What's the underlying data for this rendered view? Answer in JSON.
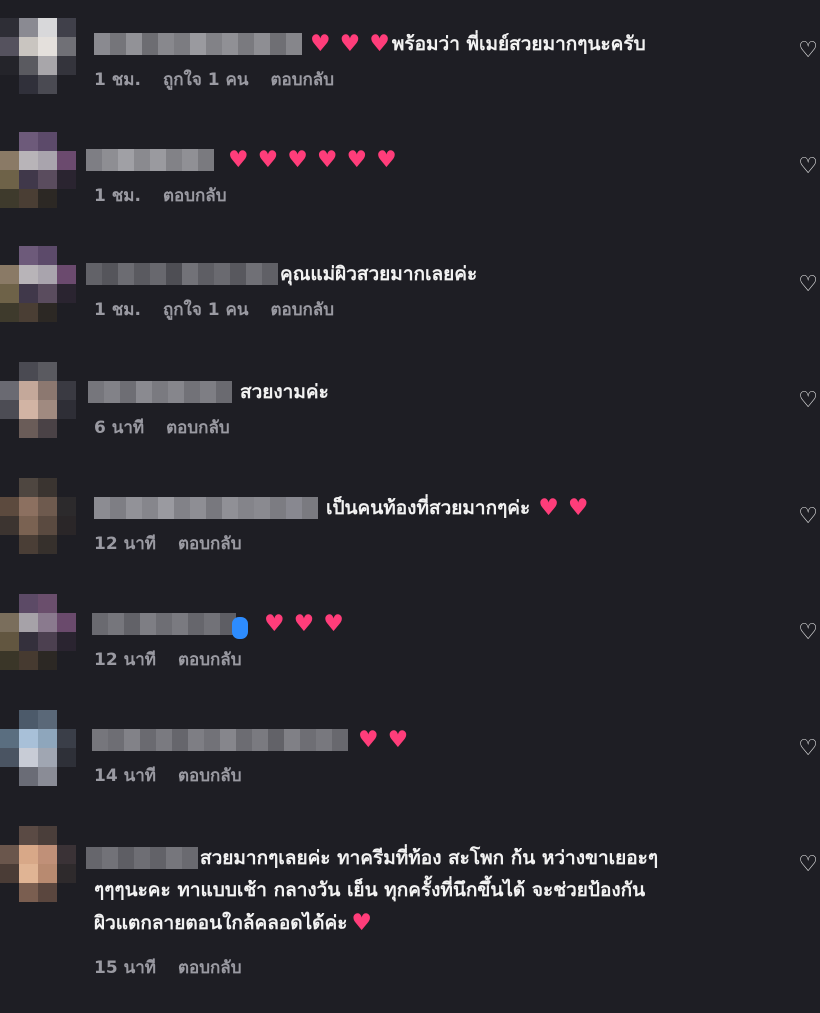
{
  "comments": [
    {
      "text": "พร้อมว่า  พี่เมย์สวยมากๆนะครับ",
      "hearts": 3,
      "heart_first": true,
      "time": "1 ชม.",
      "likes": "ถูกใจ 1 คน",
      "reply": "ตอบกลับ"
    },
    {
      "text": "",
      "hearts": 6,
      "time": "1 ชม.",
      "likes": "",
      "reply": "ตอบกลับ"
    },
    {
      "text": "คุณแม่ผิวสวยมากเลยค่ะ",
      "hearts": 0,
      "time": "1 ชม.",
      "likes": "ถูกใจ 1 คน",
      "reply": "ตอบกลับ"
    },
    {
      "text": "สวยงามค่ะ",
      "hearts": 0,
      "time": "6 นาที",
      "likes": "",
      "reply": "ตอบกลับ"
    },
    {
      "text": "เป็นคนท้องที่สวยมากๆค่ะ",
      "hearts": 2,
      "time": "12 นาที",
      "likes": "",
      "reply": "ตอบกลับ"
    },
    {
      "text": "",
      "hearts": 3,
      "time": "12 นาที",
      "likes": "",
      "reply": "ตอบกลับ"
    },
    {
      "text": "",
      "hearts": 2,
      "time": "14 นาที",
      "likes": "",
      "reply": "ตอบกลับ"
    },
    {
      "text": "สวยมากๆเลยค่ะ  ทาครีมที่ท้อง  สะโพก  ก้น  หว่างขาเยอะๆ",
      "text2": "ๆๆๆนะคะ  ทาแบบเช้า  กลางวัน  เย็น  ทุกครั้งที่นึกขึ้นได้  จะช่วยป้องกัน",
      "text3": "ผิวแตกลายตอนใกล้คลอดได้ค่ะ",
      "hearts": 1,
      "time": "15 นาที",
      "likes": "",
      "reply": "ตอบกลับ"
    }
  ],
  "colors": {
    "heart": "#ff3d7a",
    "background": "#1e1e24",
    "meta": "#9a9aa2"
  },
  "icons": {
    "heart": "heart-icon",
    "like": "like-heart-outline-icon"
  }
}
